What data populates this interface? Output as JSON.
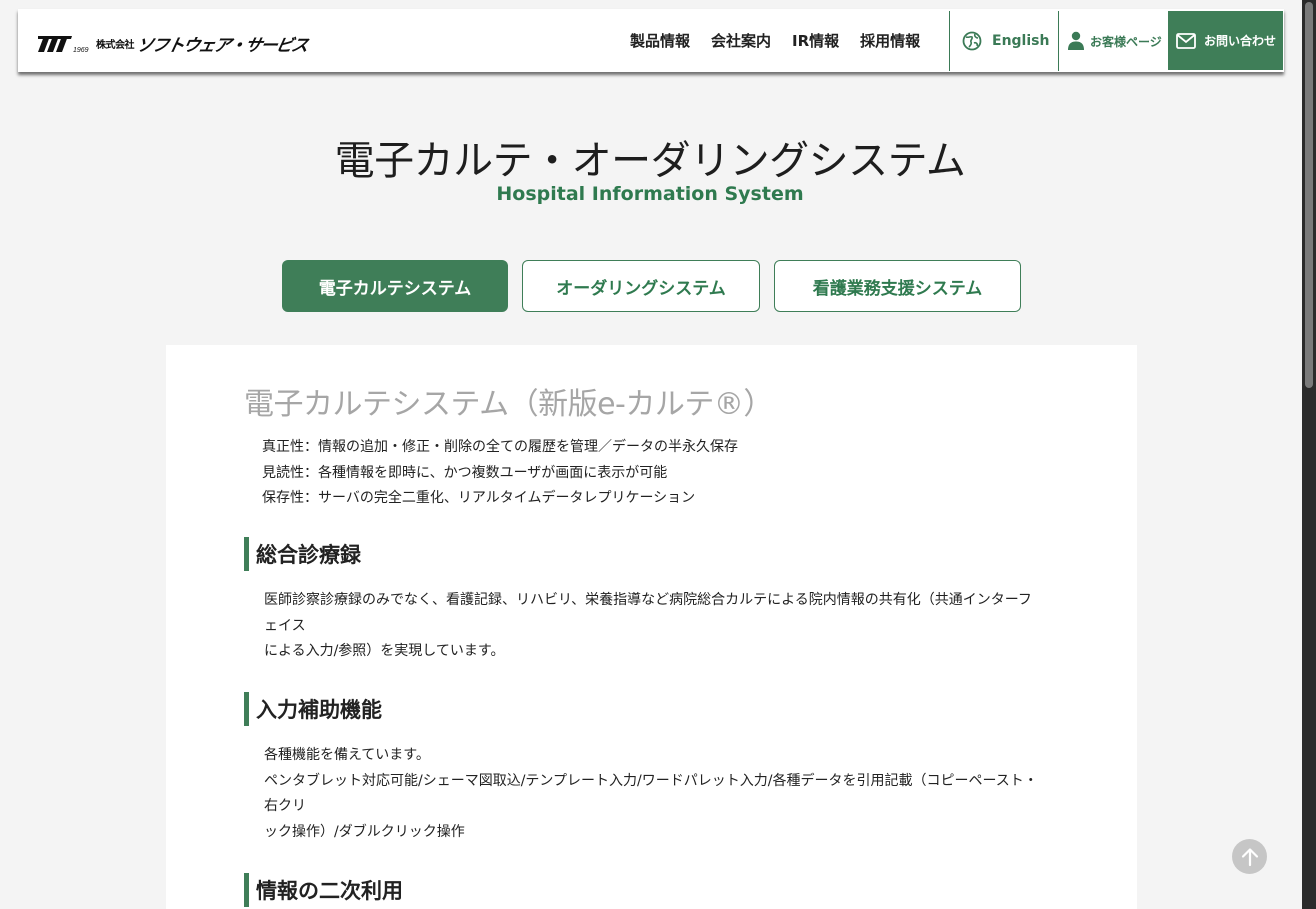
{
  "header": {
    "logo": {
      "brand_mark": "1969",
      "kabushiki": "株式会社",
      "company_name": "ソフトウェア・サービス"
    },
    "nav": [
      {
        "label": "製品情報"
      },
      {
        "label": "会社案内"
      },
      {
        "label": "IR情報"
      },
      {
        "label": "採用情報"
      }
    ],
    "english_label": "English",
    "customer_label": "お客様ページ",
    "contact_label": "お問い合わせ"
  },
  "page": {
    "title": "電子カルテ・オーダリングシステム",
    "subtitle": "Hospital Information System"
  },
  "tabs": [
    {
      "label": "電子カルテシステム",
      "active": true
    },
    {
      "label": "オーダリングシステム",
      "active": false
    },
    {
      "label": "看護業務支援システム",
      "active": false
    }
  ],
  "content": {
    "section_title": "電子カルテシステム（新版e-カルテ®）",
    "features": [
      "真正性：情報の追加・修正・削除の全ての履歴を管理／データの半永久保存",
      "見読性：各種情報を即時に、かつ複数ユーザが画面に表示が可能",
      "保存性：サーバの完全二重化、リアルタイムデータレプリケーション"
    ],
    "blocks": [
      {
        "heading": "総合診療録",
        "lines": [
          "医師診察診療録のみでなく、看護記録、リハビリ、栄養指導など病院総合カルテによる院内情報の共有化（共通インターフェイス",
          "による入力/参照）を実現しています。"
        ]
      },
      {
        "heading": "入力補助機能",
        "lines": [
          "各種機能を備えています。",
          "ペンタブレット対応可能/シェーマ図取込/テンプレート入力/ワードパレット入力/各種データを引用記載（コピーペースト・右クリ",
          "ック操作）/ダブルクリック操作"
        ]
      },
      {
        "heading": "情報の二次利用",
        "lines": []
      }
    ]
  },
  "colors": {
    "brand_green": "#3f7e58",
    "text_green": "#2f7a4f",
    "section_title_gray": "#a6a6a6",
    "page_bg": "#f4f4f4"
  },
  "icons": {
    "english": "globe-icon",
    "customer": "person-icon",
    "contact": "mail-icon",
    "to_top": "arrow-up-icon"
  }
}
